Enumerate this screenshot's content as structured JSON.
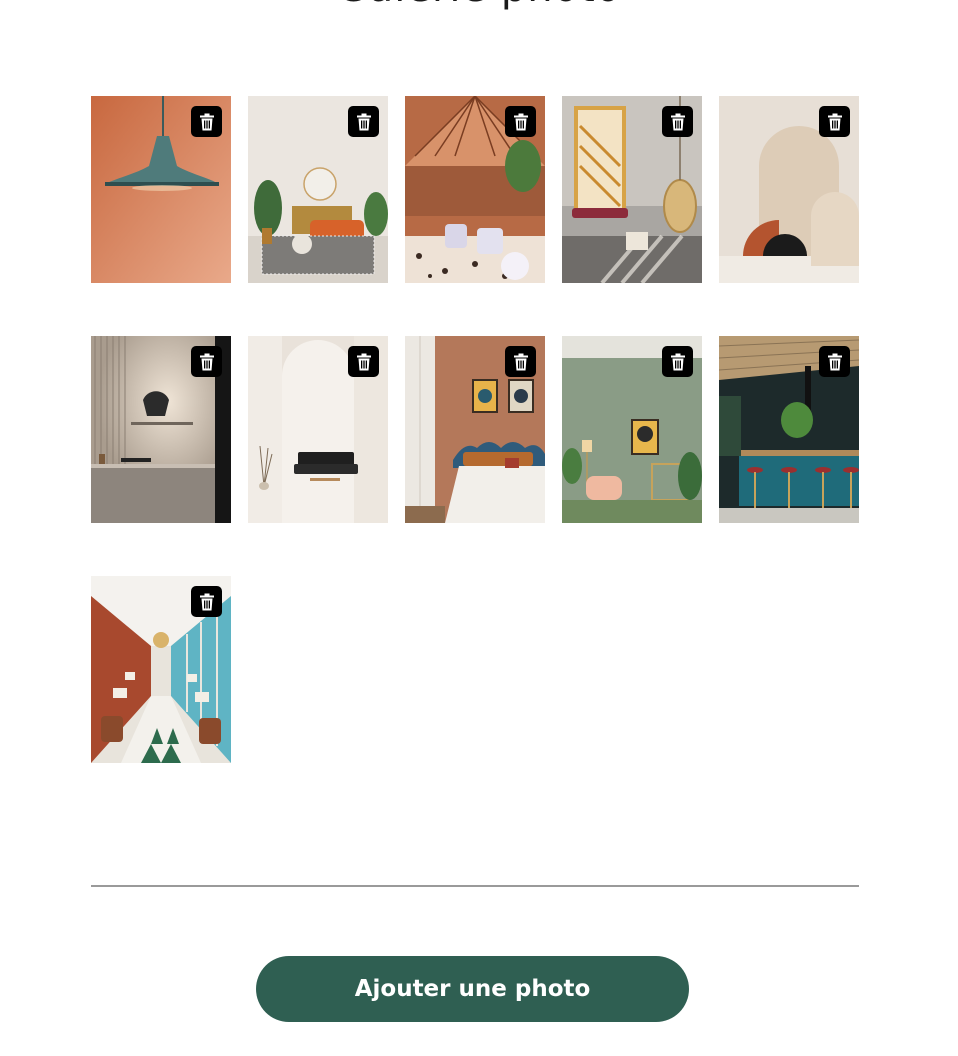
{
  "gallery": {
    "title": "Galerie photo",
    "photos": [
      {
        "subject": "pendant-lamp",
        "delete_icon": "trash-icon"
      },
      {
        "subject": "living-room",
        "delete_icon": "trash-icon"
      },
      {
        "subject": "greenhouse-cafe",
        "delete_icon": "trash-icon"
      },
      {
        "subject": "hanging-chair-lounge",
        "delete_icon": "trash-icon"
      },
      {
        "subject": "arches-decor",
        "delete_icon": "trash-icon"
      },
      {
        "subject": "kitchen-wall-light",
        "delete_icon": "trash-icon"
      },
      {
        "subject": "arched-hallway-sofa",
        "delete_icon": "trash-icon"
      },
      {
        "subject": "bedroom",
        "delete_icon": "trash-icon"
      },
      {
        "subject": "green-reading-nook",
        "delete_icon": "trash-icon"
      },
      {
        "subject": "teal-bar",
        "delete_icon": "trash-icon"
      },
      {
        "subject": "restaurant-hall",
        "delete_icon": "trash-icon"
      }
    ]
  },
  "actions": {
    "add_photo_label": "Ajouter une photo"
  },
  "colors": {
    "button_bg": "#2f5f52",
    "button_text": "#ffffff",
    "delete_bg": "#000000",
    "divider": "#9a9a9a"
  }
}
